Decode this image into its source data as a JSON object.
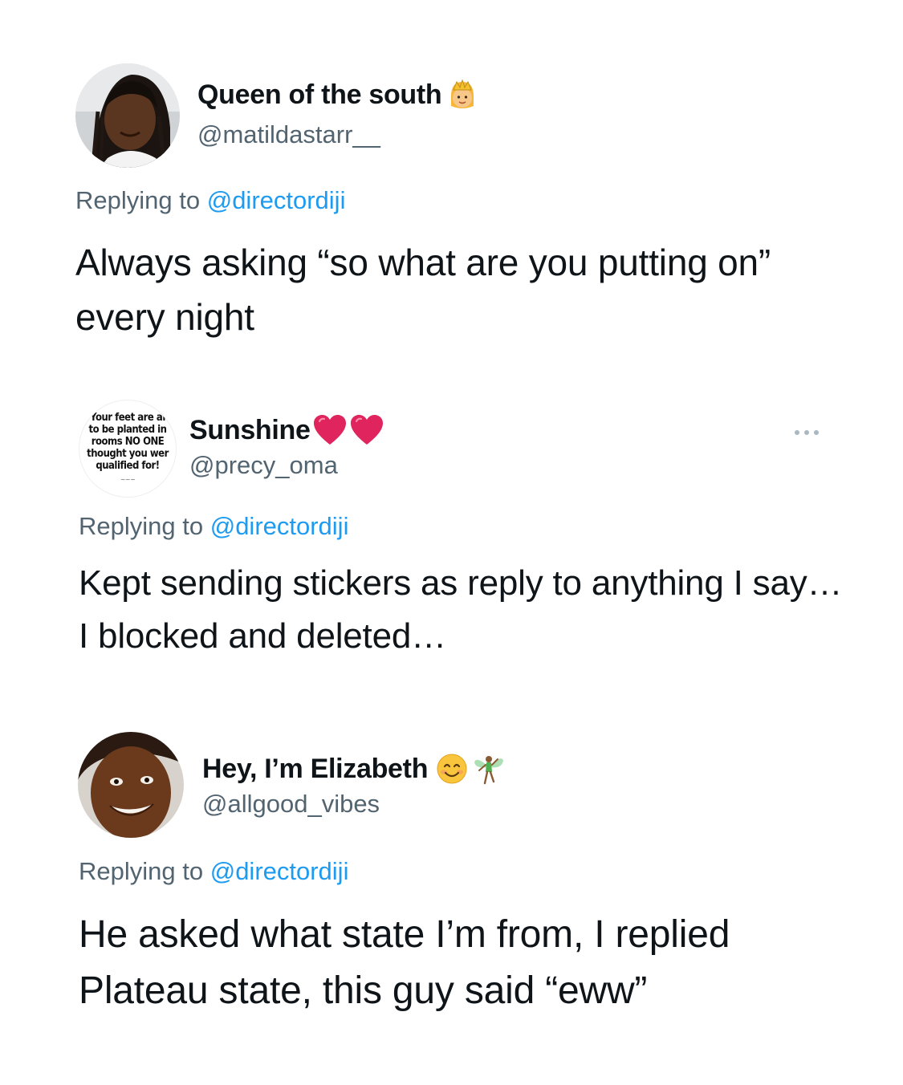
{
  "tweets": [
    {
      "name": "Queen of the south",
      "name_emojis": [
        "princess-emoji"
      ],
      "handle": "@matildastarr__",
      "replying_prefix": "Replying to ",
      "replying_to": "@directordiji",
      "text": "Always asking “so what are you putting on” every night"
    },
    {
      "name": "Sunshine",
      "name_emojis": [
        "red-heart-emoji",
        "red-heart-emoji"
      ],
      "handle": "@precy_oma",
      "avatar_text": [
        "Your feet are al",
        "to be planted in",
        "rooms NO ONE",
        "thought you wer",
        "qualified for!"
      ],
      "replying_prefix": "Replying to ",
      "replying_to": "@directordiji",
      "text": "Kept sending stickers as reply to anything I say…I blocked and deleted…"
    },
    {
      "name": "Hey, I’m Elizabeth",
      "name_emojis": [
        "smiling-face-emoji",
        "fairy-emoji"
      ],
      "handle": "@allgood_vibes",
      "replying_prefix": "Replying to ",
      "replying_to": "@directordiji",
      "text": "He asked what state I’m from, I replied Plateau state, this guy said “eww”"
    }
  ],
  "colors": {
    "name": "#0f1419",
    "secondary": "#536471",
    "mention": "#1d9bf0",
    "heart": "#e0245e"
  }
}
